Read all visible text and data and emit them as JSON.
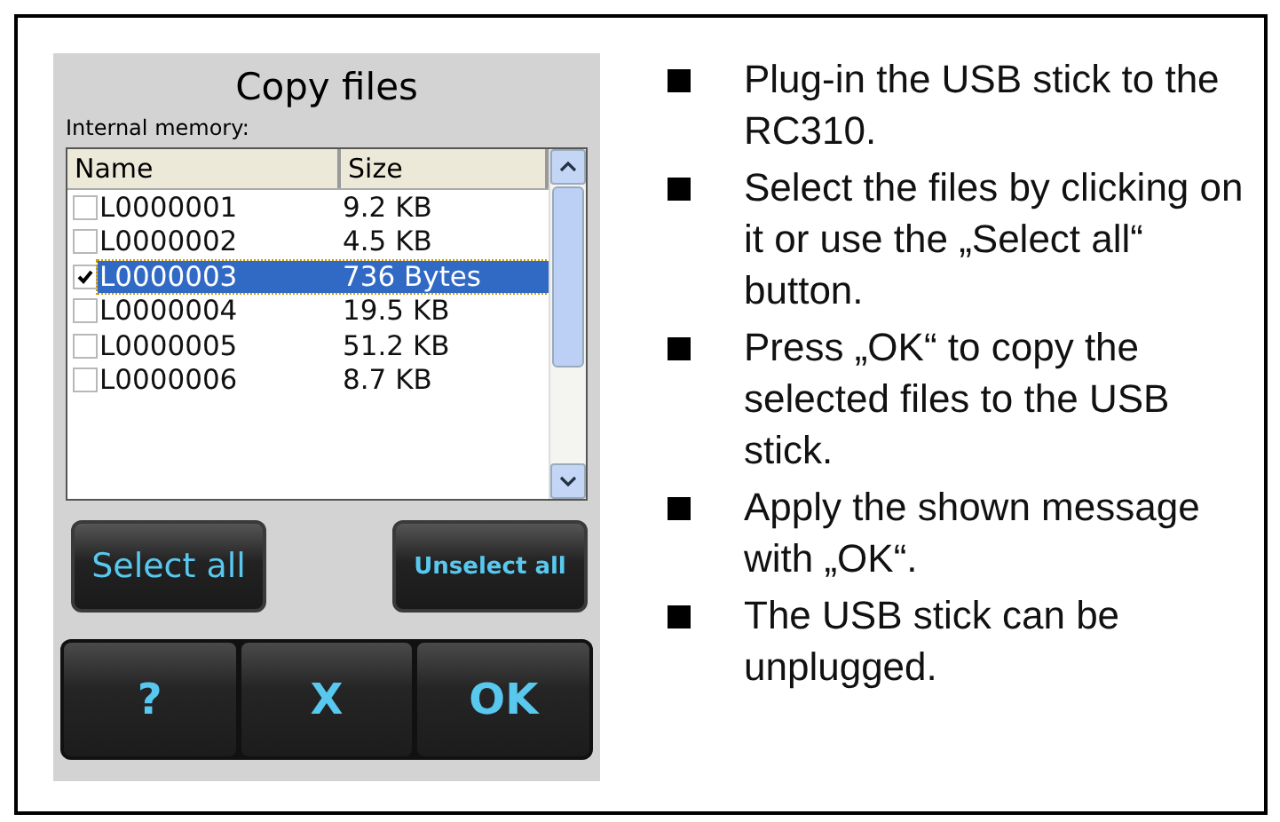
{
  "screen": {
    "title": "Copy files",
    "subtitle": "Internal memory:",
    "table": {
      "columns": [
        "Name",
        "Size"
      ],
      "rows": [
        {
          "name": "L0000001",
          "size": "9.2 KB",
          "checked": false,
          "selected": false
        },
        {
          "name": "L0000002",
          "size": "4.5 KB",
          "checked": false,
          "selected": false
        },
        {
          "name": "L0000003",
          "size": "736 Bytes",
          "checked": true,
          "selected": true
        },
        {
          "name": "L0000004",
          "size": "19.5 KB",
          "checked": false,
          "selected": false
        },
        {
          "name": "L0000005",
          "size": "51.2 KB",
          "checked": false,
          "selected": false
        },
        {
          "name": "L0000006",
          "size": "8.7 KB",
          "checked": false,
          "selected": false
        }
      ]
    },
    "buttons": [
      "Select all",
      "Unselect all"
    ],
    "bottom_buttons": [
      "?",
      "X",
      "OK"
    ]
  },
  "instructions": [
    "Plug-in the USB stick to the RC310.",
    "Select the files by clicking on it or use the „Select all“ button.",
    "Press „OK“ to copy the selected files to the USB stick.",
    "Apply the shown message with „OK“.",
    "The USB stick can be unplugged."
  ]
}
